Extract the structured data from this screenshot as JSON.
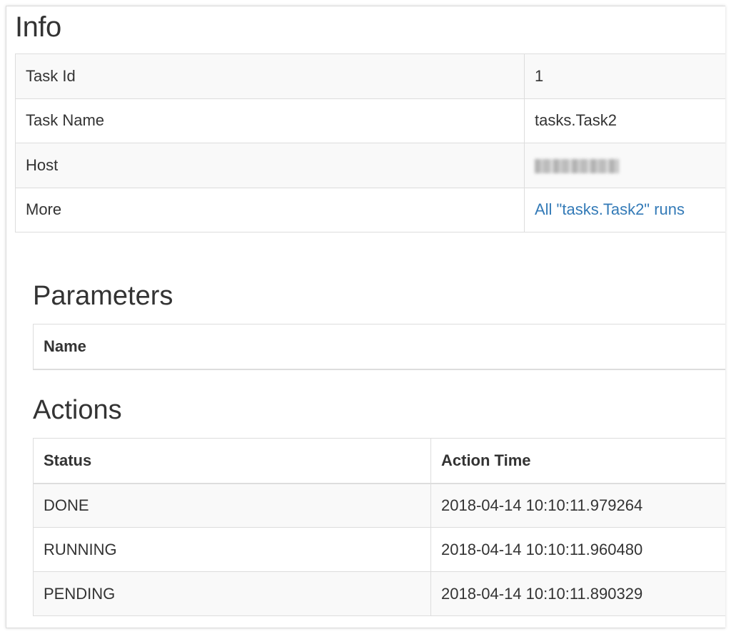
{
  "info": {
    "title": "Info",
    "rows": [
      {
        "key": "Task Id",
        "value": "1"
      },
      {
        "key": "Task Name",
        "value": "tasks.Task2"
      },
      {
        "key": "Host",
        "value": ""
      },
      {
        "key": "More",
        "value": "All \"tasks.Task2\" runs"
      }
    ]
  },
  "parameters": {
    "title": "Parameters",
    "header": "Name"
  },
  "actions": {
    "title": "Actions",
    "headers": [
      "Status",
      "Action Time"
    ],
    "rows": [
      {
        "status": "DONE",
        "time": "2018-04-14 10:10:11.979264"
      },
      {
        "status": "RUNNING",
        "time": "2018-04-14 10:10:11.960480"
      },
      {
        "status": "PENDING",
        "time": "2018-04-14 10:10:11.890329"
      }
    ]
  },
  "colors": {
    "link": "#337ab7",
    "stripe": "#f9f9f9",
    "border": "#dddddd",
    "text": "#333333"
  }
}
